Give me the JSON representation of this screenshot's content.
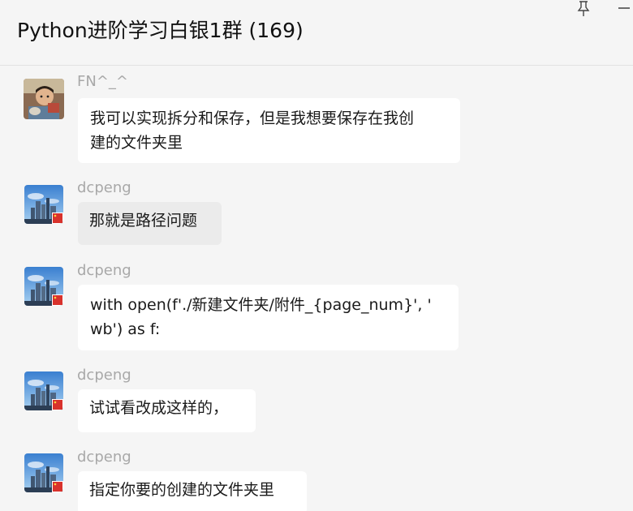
{
  "window": {
    "title": "Python进阶学习白银1群 (169)",
    "pin_icon": "pin-icon",
    "minimize_icon": "minimize-icon"
  },
  "messages": [
    {
      "sender": "FN^_^",
      "avatar": "child-photo-avatar",
      "lines": [
        "我可以实现拆分和保存，但是我想要保存在我创",
        "建的文件夹里"
      ]
    },
    {
      "sender": "dcpeng",
      "avatar": "city-skyline-avatar",
      "lines": [
        "那就是路径问题"
      ]
    },
    {
      "sender": "dcpeng",
      "avatar": "city-skyline-avatar",
      "lines": [
        "with open(f'./新建文件夹/附件_{page_num}', '",
        "wb') as f:"
      ]
    },
    {
      "sender": "dcpeng",
      "avatar": "city-skyline-avatar",
      "lines": [
        "试试看改成这样的，"
      ]
    },
    {
      "sender": "dcpeng",
      "avatar": "city-skyline-avatar",
      "lines": [
        "指定你要的创建的文件夹里"
      ]
    }
  ]
}
